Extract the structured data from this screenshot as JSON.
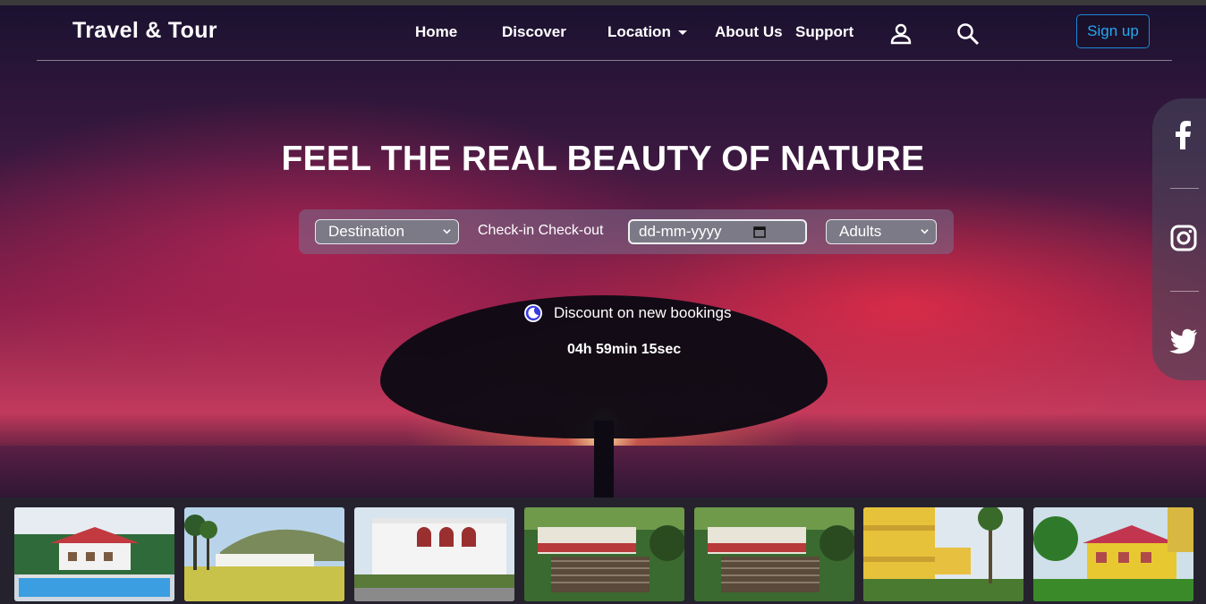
{
  "brand": "Travel & Tour",
  "nav": {
    "items": [
      "Home",
      "Discover",
      "Location",
      "About Us",
      "Support"
    ],
    "signup": "Sign up"
  },
  "hero": {
    "headline": "FEEL THE REAL BEAUTY OF NATURE"
  },
  "search": {
    "destination": "Destination",
    "check_label": "Check-in Check-out",
    "date_placeholder": "dd-mm-yyyy",
    "adults": "Adults"
  },
  "promo": {
    "text": "Discount on new bookings",
    "countdown": "04h 59min 15sec"
  },
  "social": [
    "facebook-icon",
    "instagram-icon",
    "twitter-icon"
  ],
  "gallery": [
    "villa-pool",
    "lawn-bungalow",
    "white-mansion",
    "garden-stairs",
    "garden-stairs-2",
    "yellow-house",
    "yellow-house-2"
  ],
  "colors": {
    "signup_border": "#1c86d6",
    "signup_text": "#26a8f0",
    "moon": "#3a3ae0"
  }
}
